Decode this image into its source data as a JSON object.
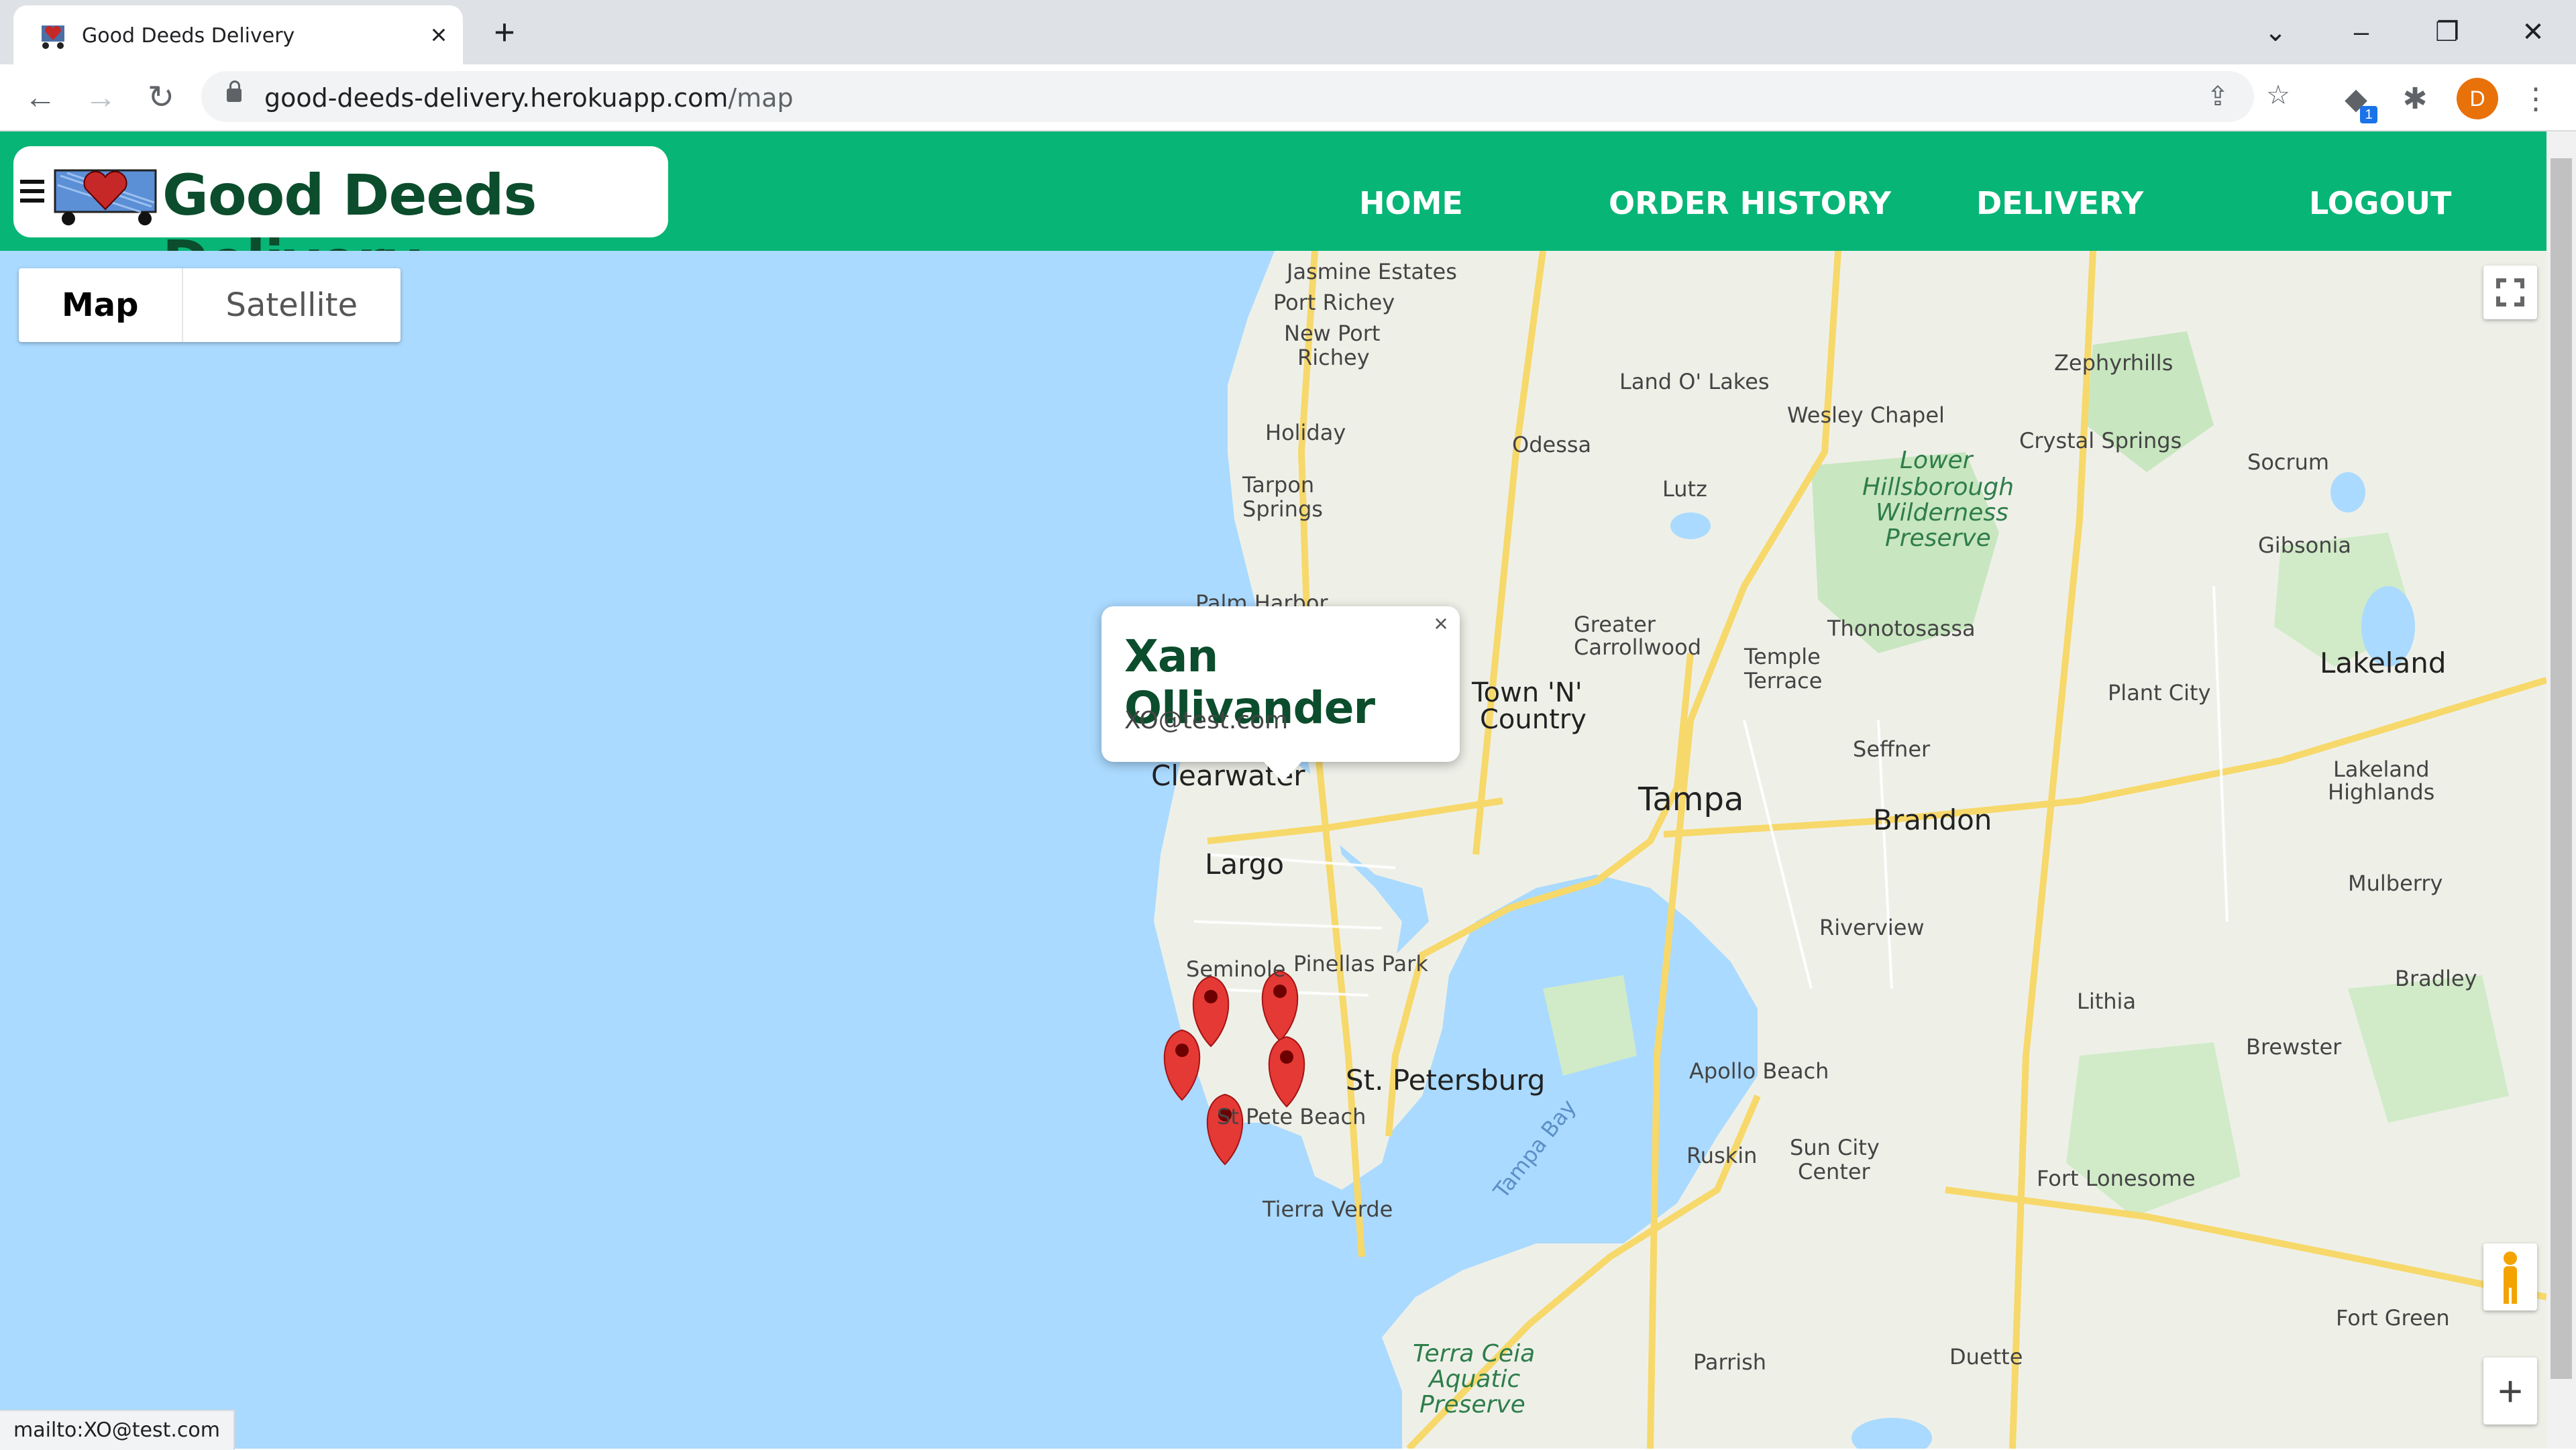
{
  "browser": {
    "tab_title": "Good Deeds Delivery",
    "url_host": "good-deeds-delivery.herokuapp.com",
    "url_path": "/map",
    "extension_badge": "1",
    "profile_initial": "D",
    "status_link": "mailto:XO@test.com"
  },
  "navbar": {
    "brand": "Good Deeds Delivery",
    "links": [
      "HOME",
      "ORDER HISTORY",
      "DELIVERY",
      "LOGOUT"
    ]
  },
  "map": {
    "type_buttons": [
      "Map",
      "Satellite"
    ],
    "selected_type": "Map",
    "popup": {
      "name": "Xan Ollivander",
      "email": "XO@test.com"
    },
    "labels": [
      "Jasmine Estates",
      "Port Richey",
      "New Port",
      "Richey",
      "Holiday",
      "Tarpon",
      "Springs",
      "Palm Harbor",
      "Odessa",
      "Land O' Lakes",
      "Wesley Chapel",
      "Zephyrhills",
      "Lutz",
      "Lower",
      "Hillsborough",
      "Wilderness",
      "Preserve",
      "Crystal Springs",
      "Socrum",
      "Gibsonia",
      "Greater",
      "Carrollwood",
      "Temple",
      "Terrace",
      "Thonotosassa",
      "Lakeland",
      "Town 'N'",
      "Country",
      "Tampa",
      "Seffner",
      "Plant City",
      "Brandon",
      "Lakeland",
      "Highlands",
      "Clearwater",
      "Largo",
      "Seminole",
      "Pinellas Park",
      "Riverview",
      "Mulberry",
      "Lithia",
      "St. Petersburg",
      "Apollo Beach",
      "St Pete Beach",
      "Sun City",
      "Center",
      "Ruskin",
      "Fort Lonesome",
      "Brewster",
      "Bradley",
      "Tierra Verde",
      "Tampa Bay",
      "Parrish",
      "Duette",
      "Fort Green",
      "Terra Ceia",
      "Aquatic",
      "Preserve"
    ],
    "markers_count": 5
  },
  "colors": {
    "nav_green": "#07b577",
    "brand_text": "#0b4d2c",
    "water": "#aadaff",
    "land": "#eef0e8",
    "marker": "#e53935"
  }
}
